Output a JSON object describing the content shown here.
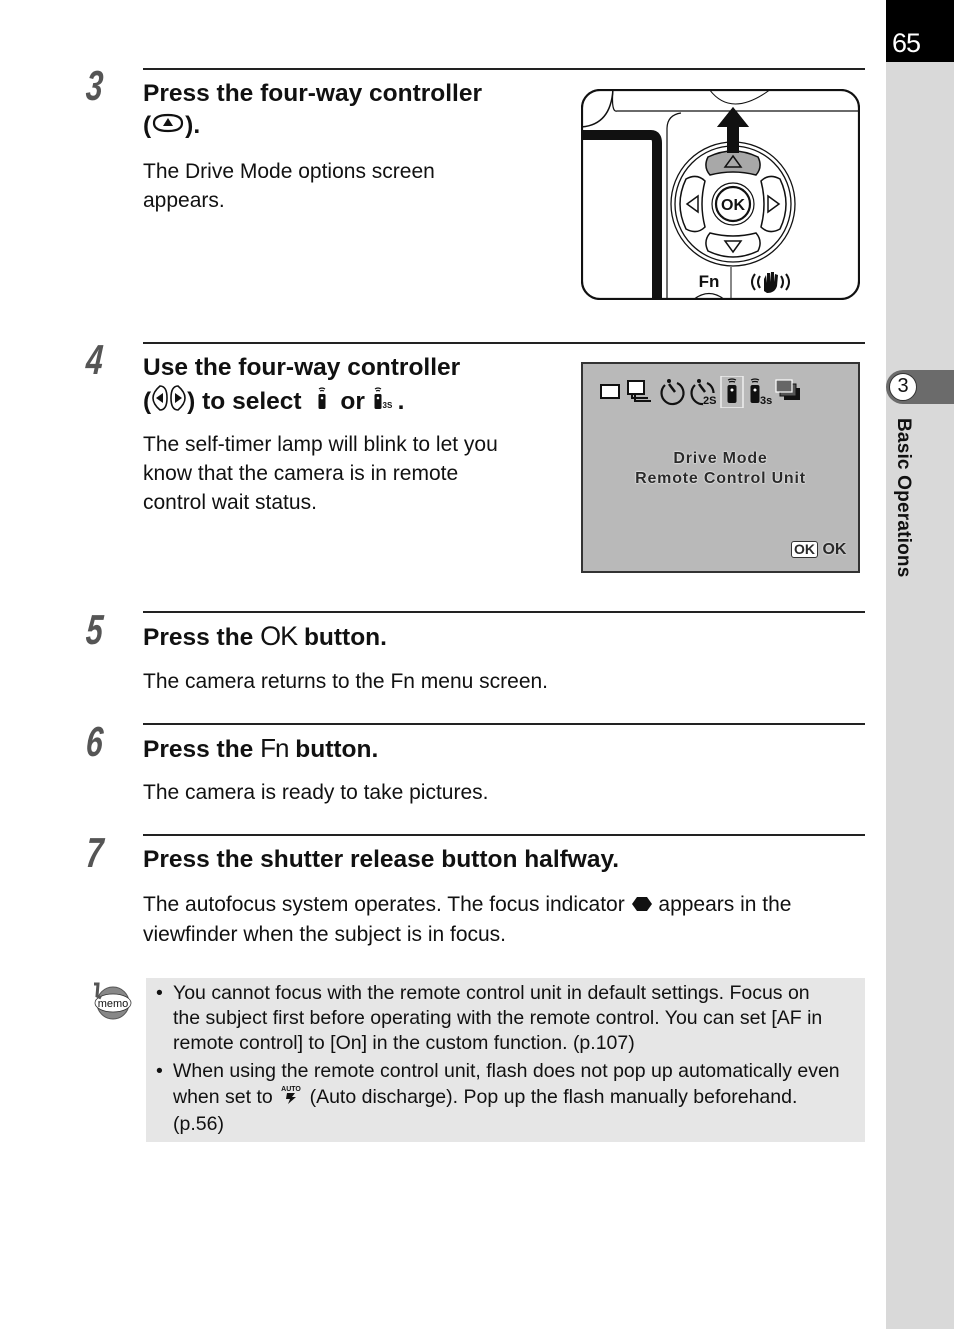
{
  "page": {
    "number": "65",
    "chapter_number": "3",
    "chapter_title": "Basic Operations"
  },
  "steps": [
    {
      "number": "3",
      "title_line1": "Press the four-way controller",
      "title_line2_prefix": "(",
      "title_line2_icon": "four-way-up-icon",
      "title_line2_suffix": ").",
      "body_line1": "The Drive Mode options screen",
      "body_line2": "appears."
    },
    {
      "number": "4",
      "title_line1": "Use the four-way controller",
      "title_line2_prefix": "(",
      "title_line2_icons": [
        "four-way-left-icon",
        "four-way-right-icon"
      ],
      "title_line2_mid": ") to select",
      "title_line2_or": "or",
      "title_line2_end": ".",
      "remote_3s_sub": "3S",
      "body_lines": [
        "The self-timer lamp will blink to let you",
        "know that the camera is in remote",
        "control wait status."
      ]
    },
    {
      "number": "5",
      "title_prefix": "Press the",
      "title_key": "OK",
      "title_suffix": "button.",
      "body": "The camera returns to the Fn menu screen."
    },
    {
      "number": "6",
      "title_prefix": "Press the",
      "title_key": "Fn",
      "title_suffix": "button.",
      "body": "The camera is ready to take pictures."
    },
    {
      "number": "7",
      "title": "Press the shutter release button halfway.",
      "body_line1_prefix": "The autofocus system operates. The focus indicator",
      "body_line1_icon": "focus-indicator-icon",
      "body_line1_suffix": "appears in the",
      "body_line2": "viewfinder when the subject is in focus."
    }
  ],
  "figure_controller": {
    "ok_label": "OK",
    "fn_label": "Fn",
    "highlighted_button": "up"
  },
  "figure_lcd": {
    "icons": [
      "single-frame-icon",
      "continuous-icon",
      "self-timer-12s-icon",
      "self-timer-2s-icon",
      "remote-control-icon",
      "remote-control-3s-icon",
      "auto-bracket-icon"
    ],
    "selected_icon": "remote-control-icon",
    "timer_2s_label": "2S",
    "remote_3s_label": "3s",
    "title": "Drive Mode",
    "subtitle": "Remote Control Unit",
    "ok_box_label": "OK",
    "ok_label": "OK"
  },
  "memo": {
    "icon_label": "memo",
    "items": [
      {
        "lines": [
          "You cannot focus with the remote control unit in default settings. Focus on",
          "the subject first before operating with the remote control. You can set [AF in",
          "remote control] to [On] in the custom function. (p.107)"
        ]
      },
      {
        "line1": "When using the remote control unit, flash does not pop up automatically even",
        "line2_prefix": "when set to",
        "line2_icon": "auto-flash-icon",
        "auto_label": "AUTO",
        "line2_suffix": "(Auto discharge). Pop up the flash manually beforehand.",
        "line3": "(p.56)"
      }
    ],
    "bullet": "•"
  }
}
